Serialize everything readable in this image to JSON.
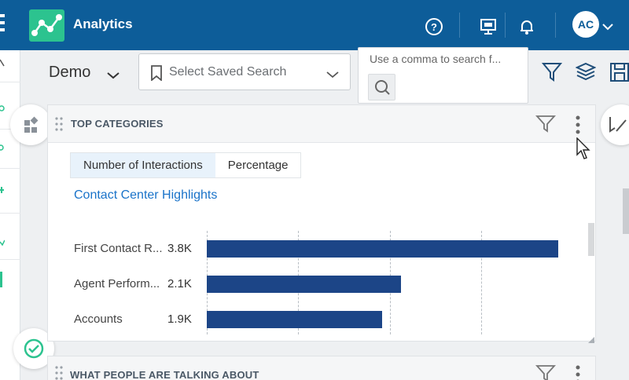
{
  "header": {
    "app_title": "Analytics",
    "user_initials": "AC",
    "icons": [
      "menu-icon",
      "analytics-logo-icon",
      "help-icon",
      "presentation-icon",
      "bell-icon",
      "chevron-down-icon"
    ]
  },
  "toolbar": {
    "view_name": "Demo",
    "saved_search_placeholder": "Select Saved Search",
    "search_placeholder": "Use a comma to search f...",
    "icons": [
      "filter-icon",
      "layers-icon",
      "save-icon"
    ]
  },
  "card": {
    "title": "TOP CATEGORIES",
    "tabs": [
      {
        "label": "Number of Interactions",
        "active": true
      },
      {
        "label": "Percentage",
        "active": false
      }
    ],
    "link_text": "Contact Center Highlights"
  },
  "card2": {
    "title": "WHAT PEOPLE ARE TALKING ABOUT"
  },
  "chart_data": {
    "type": "bar",
    "orientation": "horizontal",
    "categories": [
      "First Contact R...",
      "Agent Perform...",
      "Accounts"
    ],
    "value_labels": [
      "3.8K",
      "2.1K",
      "1.9K"
    ],
    "values": [
      3800,
      2100,
      1900
    ],
    "xlim": [
      0,
      4000
    ],
    "grid": true
  },
  "colors": {
    "header_bg": "#0d5d99",
    "logo_bg": "#2cc38f",
    "bar": "#1c4587",
    "link": "#1a73c9",
    "accent_green": "#2cc38f"
  }
}
